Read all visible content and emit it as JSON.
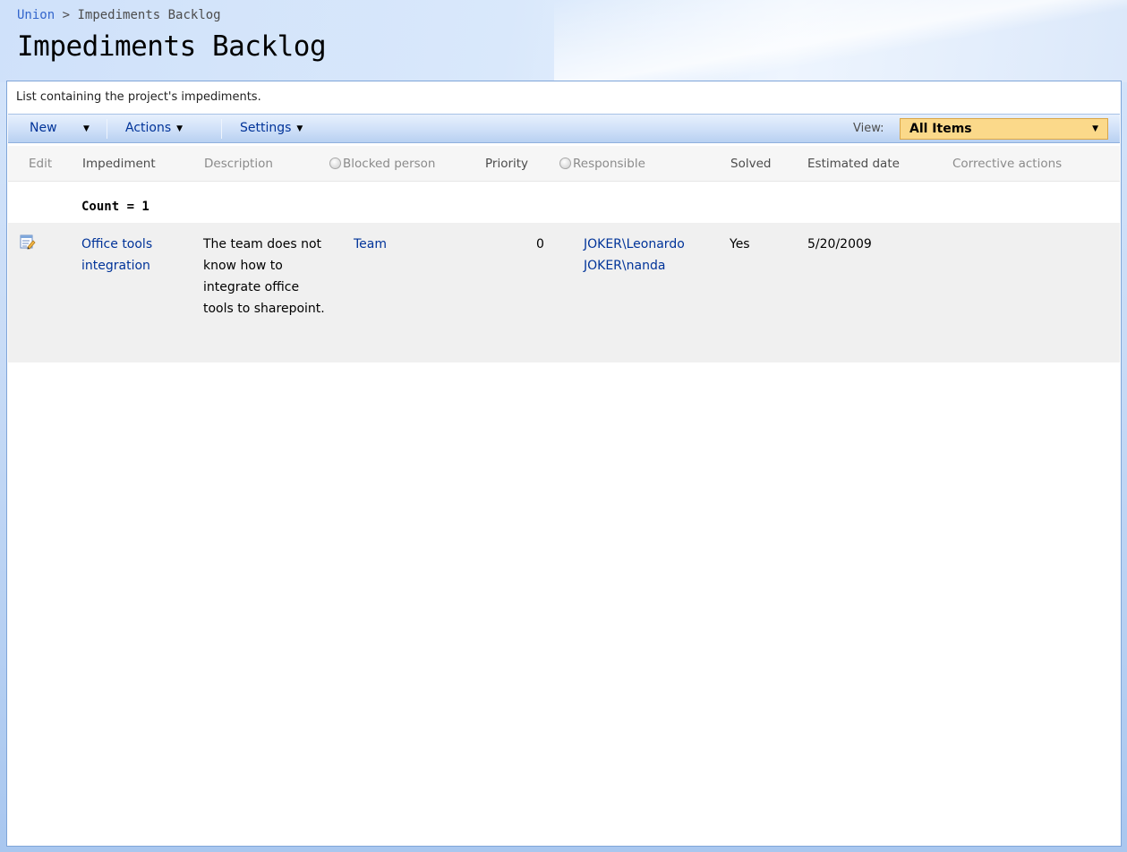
{
  "breadcrumb": {
    "site": "Union",
    "separator": ">",
    "current": "Impediments Backlog"
  },
  "page_title": "Impediments Backlog",
  "description": "List containing the project's impediments.",
  "toolbar": {
    "new_label": "New",
    "actions_label": "Actions",
    "settings_label": "Settings",
    "view_label": "View:",
    "view_selected": "All Items"
  },
  "columns": {
    "edit": "Edit",
    "impediment": "Impediment",
    "description": "Description",
    "blocked_person": "Blocked person",
    "priority": "Priority",
    "responsible": "Responsible",
    "solved": "Solved",
    "estimated_date": "Estimated date",
    "corrective_actions": "Corrective actions"
  },
  "group": {
    "count_label": "Count = 1"
  },
  "rows": [
    {
      "impediment": "Office tools integration",
      "description": "The team does not know how to integrate office tools to sharepoint.",
      "blocked_person": "Team",
      "priority": "0",
      "responsible": [
        "JOKER\\Leonardo",
        "JOKER\\nanda"
      ],
      "solved": "Yes",
      "estimated_date": "5/20/2009",
      "corrective_actions": ""
    }
  ],
  "icons": {
    "dropdown": "dropdown-arrow-icon",
    "edit": "edit-item-icon",
    "presence": "presence-radio-icon"
  },
  "colors": {
    "link": "#003399",
    "view_select_bg": "#fbd98a",
    "toolbar_bg": "#cfe0f8",
    "frame_border": "#7fa5d8"
  }
}
